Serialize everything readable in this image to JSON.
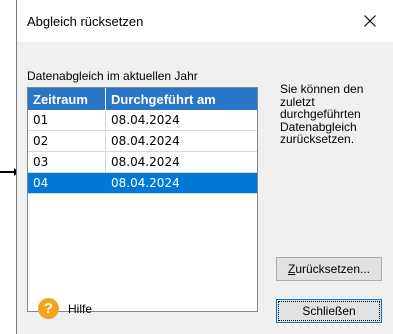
{
  "dialog": {
    "title": "Abgleich rücksetzen",
    "section_label": "Datenabgleich im aktuellen Jahr",
    "info_text": "Sie können den zuletzt durchgeführten Datenabgleich zurücksetzen.",
    "columns": [
      "Zeitraum",
      "Durchgeführt am"
    ],
    "rows": [
      {
        "period": "01",
        "date": "08.04.2024"
      },
      {
        "period": "02",
        "date": "08.04.2024"
      },
      {
        "period": "03",
        "date": "08.04.2024"
      },
      {
        "period": "04",
        "date": "08.04.2024"
      }
    ],
    "selected_row": "04",
    "reset_button": {
      "accel": "Z",
      "rest": "urücksetzen..."
    },
    "close_button": "Schließen",
    "help_label": "Hilfe",
    "help_icon_glyph": "?"
  },
  "icons": [
    "close-icon",
    "help-icon",
    "pointer-arrow-icon"
  ],
  "colors": {
    "header": "#2a76c6",
    "selection": "#0078d7",
    "help": "#f7a21b"
  }
}
